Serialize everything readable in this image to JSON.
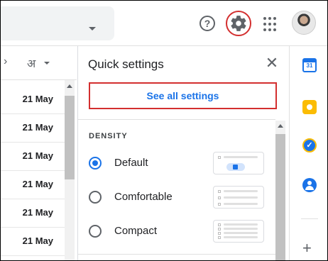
{
  "header": {
    "help_icon": "help-circle-icon",
    "help_glyph": "?",
    "settings_icon": "gear-icon",
    "apps_icon": "apps-grid-icon",
    "avatar_icon": "user-avatar"
  },
  "mail_list": {
    "prev_glyph": "›",
    "language_label": "अ",
    "rows": [
      {
        "date": "21 May"
      },
      {
        "date": "21 May"
      },
      {
        "date": "21 May"
      },
      {
        "date": "21 May"
      },
      {
        "date": "21 May"
      },
      {
        "date": "21 May"
      }
    ]
  },
  "quick_settings": {
    "title": "Quick settings",
    "close_glyph": "✕",
    "see_all_label": "See all settings",
    "density_heading": "DENSITY",
    "density_options": [
      {
        "label": "Default",
        "selected": true
      },
      {
        "label": "Comfortable",
        "selected": false
      },
      {
        "label": "Compact",
        "selected": false
      }
    ]
  },
  "side_panel": {
    "calendar_day": "31",
    "calendar_icon": "calendar-icon",
    "keep_icon": "keep-icon",
    "tasks_icon": "tasks-icon",
    "tasks_glyph": "✓",
    "contacts_icon": "contacts-icon",
    "add_glyph": "+"
  },
  "colors": {
    "accent_blue": "#1a73e8",
    "highlight_red": "#d32f2f"
  }
}
